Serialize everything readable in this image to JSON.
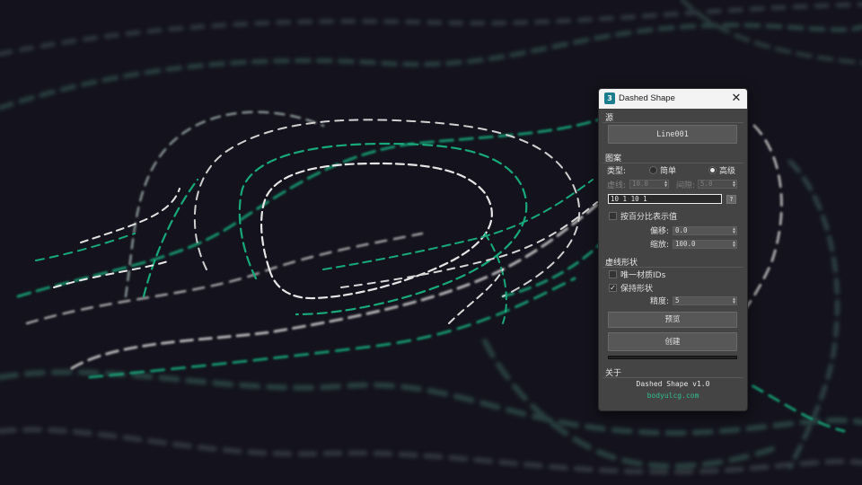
{
  "window": {
    "title": "Dashed Shape",
    "app_icon_glyph": "3",
    "close_glyph": "✕"
  },
  "source": {
    "section": "源",
    "object_button": "Line001"
  },
  "pattern": {
    "section": "图案",
    "type_label": "类型:",
    "simple_label": "简单",
    "advanced_label": "高级",
    "selected_type": "advanced",
    "dash_label": "虚线:",
    "dash_value": "10.0",
    "gap_label": "间隙:",
    "gap_value": "5.0",
    "pattern_value": "10 1 10 1",
    "help_label": "?",
    "percent_label": "按百分比表示值",
    "percent_checked": false,
    "offset_label": "偏移:",
    "offset_value": "0.0",
    "scale_label": "缩放:",
    "scale_value": "100.0"
  },
  "dash_shape": {
    "section": "虚线形状",
    "unique_ids_label": "唯一材质IDs",
    "unique_ids_checked": false,
    "keep_shape_label": "保持形状",
    "keep_shape_checked": true,
    "precision_label": "精度:",
    "precision_value": "5",
    "preview_button": "预览",
    "create_button": "创建"
  },
  "about": {
    "section": "关于",
    "version": "Dashed Shape v1.0",
    "url": "bodyulcg.com",
    "url_color": "#2fbf8f"
  },
  "colors": {
    "accent_teal": "#18a97a",
    "dash_white": "#d8d8d8",
    "background": "#14131d"
  }
}
